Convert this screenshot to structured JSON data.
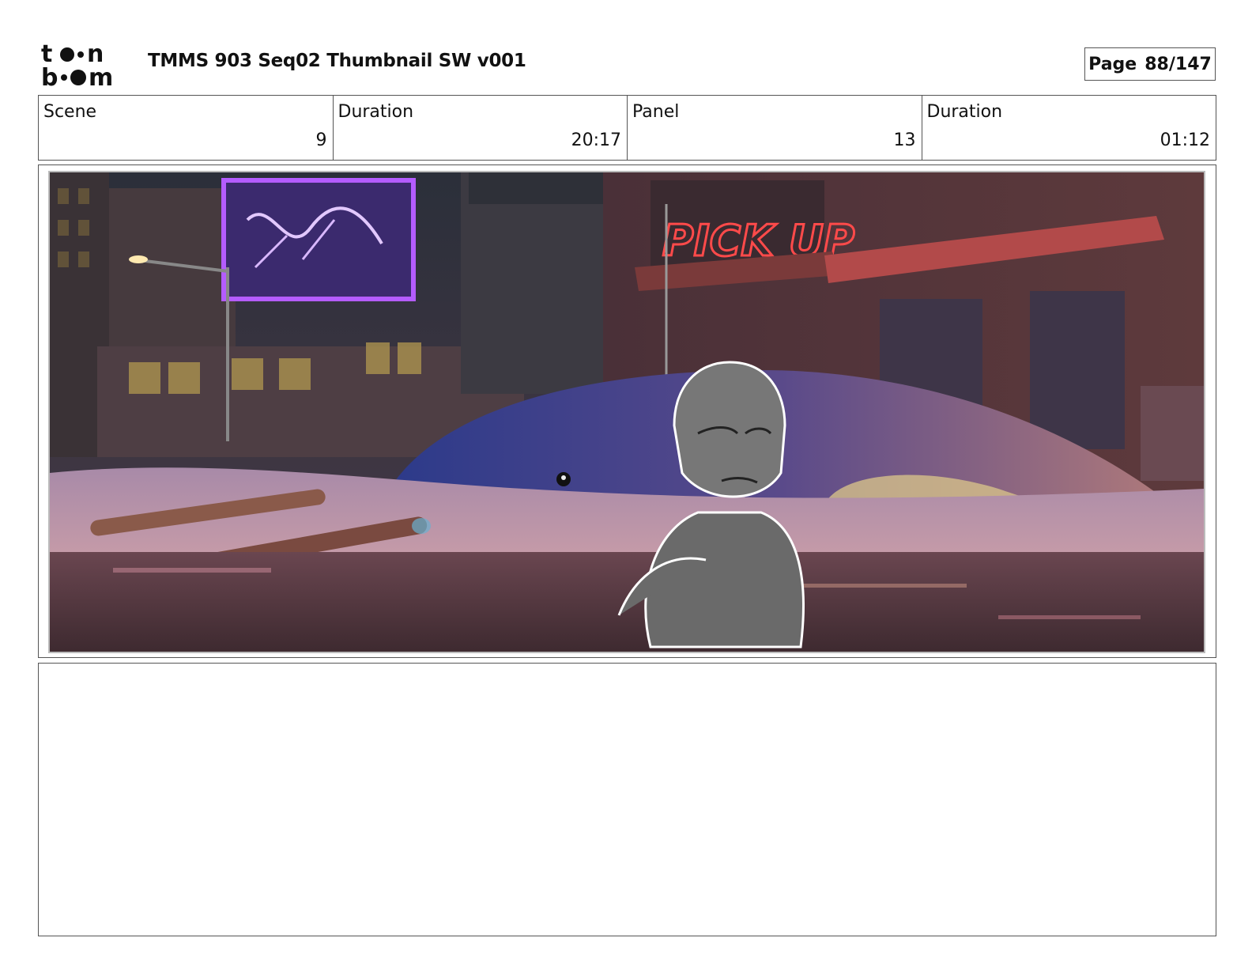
{
  "logo": {
    "name": "toon boom",
    "icon": "toon-boom-logo"
  },
  "header": {
    "title": "TMMS 903 Seq02 Thumbnail SW v001",
    "page_label": "Page",
    "page_value": "88/147"
  },
  "info": {
    "scene_label": "Scene",
    "scene_value": "9",
    "scene_duration_label": "Duration",
    "scene_duration_value": "20:17",
    "panel_label": "Panel",
    "panel_value": "13",
    "panel_duration_label": "Duration",
    "panel_duration_value": "01:12"
  },
  "panel": {
    "sign_text": "PICK UP",
    "colors": {
      "sky": "#3a2f3e",
      "neon_purple": "#a64cff",
      "neon_red": "#ff3b3b",
      "whale": "#3b3f7a",
      "water": "#b98aa8"
    }
  },
  "notes": {
    "text": ""
  }
}
